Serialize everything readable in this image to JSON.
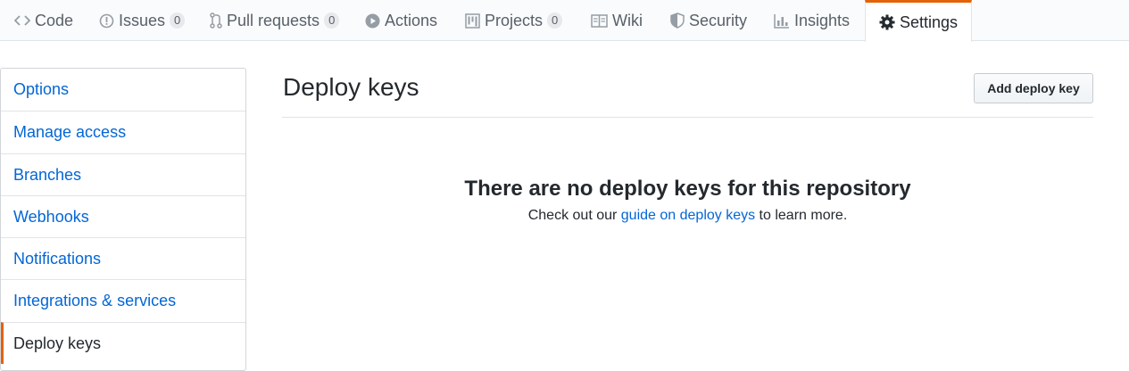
{
  "repo_nav": {
    "tabs": [
      {
        "label": "Code",
        "icon": "code-icon"
      },
      {
        "label": "Issues",
        "icon": "issue-opened-icon",
        "count": "0"
      },
      {
        "label": "Pull requests",
        "icon": "git-pull-request-icon",
        "count": "0"
      },
      {
        "label": "Actions",
        "icon": "play-icon"
      },
      {
        "label": "Projects",
        "icon": "project-icon",
        "count": "0"
      },
      {
        "label": "Wiki",
        "icon": "book-icon"
      },
      {
        "label": "Security",
        "icon": "shield-icon"
      },
      {
        "label": "Insights",
        "icon": "graph-icon"
      },
      {
        "label": "Settings",
        "icon": "gear-icon",
        "selected": true
      }
    ]
  },
  "settings_menu": {
    "items": [
      {
        "label": "Options"
      },
      {
        "label": "Manage access"
      },
      {
        "label": "Branches"
      },
      {
        "label": "Webhooks"
      },
      {
        "label": "Notifications"
      },
      {
        "label": "Integrations & services"
      },
      {
        "label": "Deploy keys",
        "selected": true
      }
    ]
  },
  "main": {
    "title": "Deploy keys",
    "add_button": "Add deploy key",
    "blankslate": {
      "heading": "There are no deploy keys for this repository",
      "text_before": "Check out our ",
      "link_text": "guide on deploy keys",
      "text_after": " to learn more."
    }
  },
  "colors": {
    "accent": "#e36209",
    "link": "#0366d6",
    "text": "#24292e",
    "muted": "#586069"
  }
}
